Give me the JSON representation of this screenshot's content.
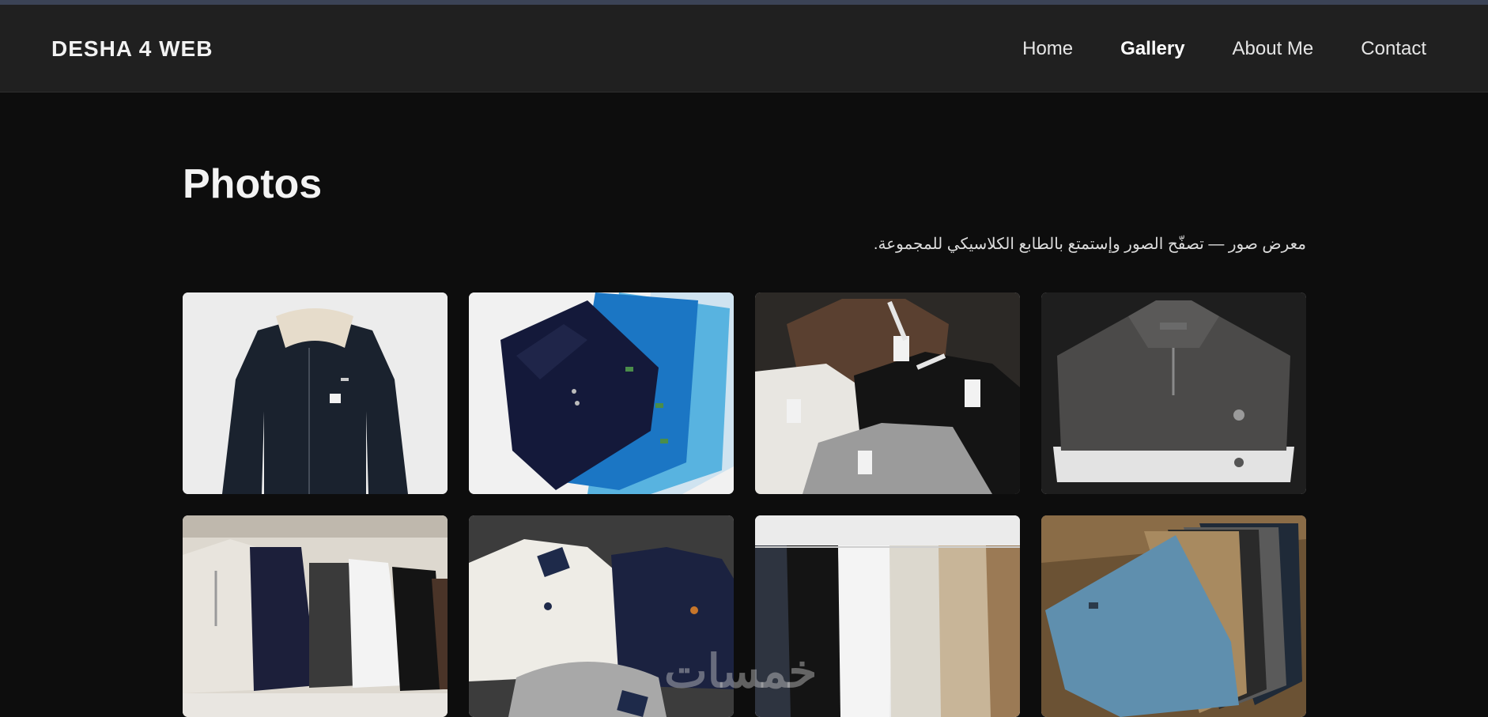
{
  "header": {
    "brand": "DESHA 4 WEB",
    "nav": [
      "Home",
      "Gallery",
      "About Me",
      "Contact"
    ],
    "active_nav": "Gallery"
  },
  "main": {
    "title": "Photos",
    "subtitle": "معرض صور — تصفّح الصور وإستمتع بالطابع الكلاسيكي للمجموعة."
  },
  "gallery": {
    "photos": [
      "navy-zip-jacket",
      "folded-polo-shirts",
      "knit-polo-shirts",
      "quarter-zip-sweaters",
      "cable-knit-quarter-zips",
      "cable-knit-crewnecks",
      "chino-pants-hanging",
      "folded-chino-pants"
    ]
  },
  "watermark": "خمسات",
  "colors": {
    "page_bg": "#0d0d0d",
    "navbar_bg": "#202020",
    "text": "#f2f2f2"
  }
}
